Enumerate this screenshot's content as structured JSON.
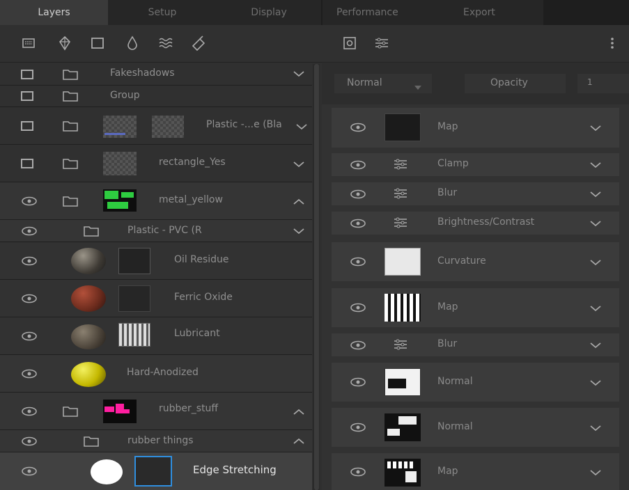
{
  "tabs": [
    "Layers",
    "Setup",
    "Display",
    "Performance",
    "Export"
  ],
  "left_toolbar_icons": [
    "texture-grid-icon",
    "fill-layer-icon",
    "rectangle-icon",
    "drop-icon",
    "waves-icon",
    "smart-material-icon"
  ],
  "layers": [
    {
      "name": "Fakeshadows",
      "visibility": "checkbox",
      "type": "folder",
      "chevron": "down"
    },
    {
      "name": "Group",
      "visibility": "checkbox",
      "type": "folder",
      "chevron": "none"
    },
    {
      "name": "Plastic -...e (Bla",
      "visibility": "checkbox",
      "type": "folder",
      "chevron": "down"
    },
    {
      "name": "rectangle_Yes",
      "visibility": "checkbox",
      "type": "folder",
      "chevron": "down"
    },
    {
      "name": "metal_yellow",
      "visibility": "eye",
      "type": "folder",
      "chevron": "up"
    },
    {
      "name": "Plastic - PVC (R",
      "visibility": "eye",
      "type": "folder",
      "chevron": "down"
    },
    {
      "name": "Oil Residue",
      "visibility": "eye",
      "type": "fill",
      "chevron": "none"
    },
    {
      "name": "Ferric Oxide",
      "visibility": "eye",
      "type": "fill",
      "chevron": "none"
    },
    {
      "name": "Lubricant",
      "visibility": "eye",
      "type": "fill",
      "chevron": "none"
    },
    {
      "name": "Hard-Anodized",
      "visibility": "eye",
      "type": "fill",
      "chevron": "none"
    },
    {
      "name": "rubber_stuff",
      "visibility": "eye",
      "type": "folder",
      "chevron": "up"
    },
    {
      "name": "rubber things",
      "visibility": "eye",
      "type": "folder",
      "chevron": "up"
    },
    {
      "name": "Edge Stretching",
      "visibility": "eye",
      "type": "fill",
      "chevron": "none",
      "selected": true
    }
  ],
  "right_toolbar": {
    "icons": [
      "mask-icon",
      "filter-sliders-icon",
      "more-options-icon"
    ]
  },
  "blend": {
    "mode": "Normal",
    "opacity_label": "Opacity",
    "opacity_value": "1"
  },
  "effects": [
    {
      "name": "Map",
      "kind": "image"
    },
    {
      "name": "Clamp",
      "kind": "filter"
    },
    {
      "name": "Blur",
      "kind": "filter"
    },
    {
      "name": "Brightness/Contrast",
      "kind": "filter"
    },
    {
      "name": "Curvature",
      "kind": "image"
    },
    {
      "name": "Map",
      "kind": "image"
    },
    {
      "name": "Blur",
      "kind": "filter"
    },
    {
      "name": "Normal",
      "kind": "image"
    },
    {
      "name": "Normal",
      "kind": "image"
    },
    {
      "name": "Map",
      "kind": "image"
    }
  ],
  "colors": {
    "accent": "#2f8fe0",
    "panel": "#2f2f2f",
    "row_selected": "#3f3f3f"
  }
}
